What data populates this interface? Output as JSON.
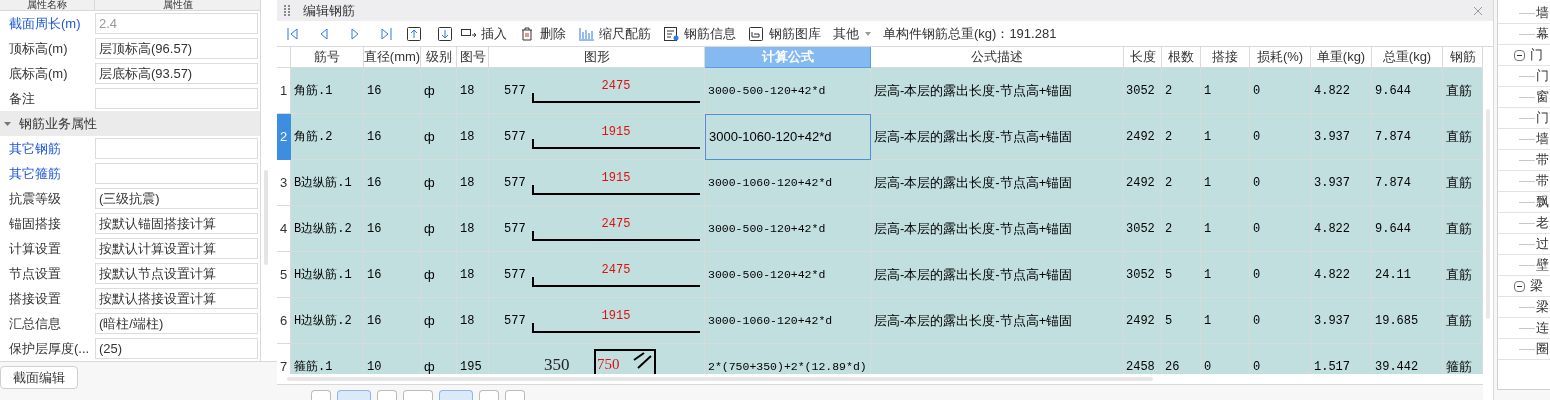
{
  "properties_panel": {
    "columns": [
      "属性名称",
      "属性值"
    ],
    "rows": [
      {
        "kind": "row",
        "label": "截面周长(m)",
        "value": "2.4",
        "emphasized": true,
        "disabled": true
      },
      {
        "kind": "row",
        "label": "顶标高(m)",
        "value": "层顶标高(96.57)",
        "emphasized": false,
        "disabled": false
      },
      {
        "kind": "row",
        "label": "底标高(m)",
        "value": "层底标高(93.57)",
        "emphasized": false,
        "disabled": false
      },
      {
        "kind": "row",
        "label": "备注",
        "emphasized": false
      },
      {
        "kind": "group",
        "label": "钢筋业务属性",
        "expanded": true
      },
      {
        "kind": "row",
        "label": "其它钢筋",
        "emphasized": true
      },
      {
        "kind": "row",
        "label": "其它箍筋",
        "emphasized": true
      },
      {
        "kind": "row",
        "label": "抗震等级",
        "value": "(三级抗震)",
        "emphasized": false,
        "disabled": false
      },
      {
        "kind": "row",
        "label": "锚固搭接",
        "value": "按默认锚固搭接计算",
        "emphasized": false,
        "disabled": false
      },
      {
        "kind": "row",
        "label": "计算设置",
        "value": "按默认计算设置计算",
        "emphasized": false,
        "disabled": false
      },
      {
        "kind": "row",
        "label": "节点设置",
        "value": "按默认节点设置计算",
        "emphasized": false,
        "disabled": false
      },
      {
        "kind": "row",
        "label": "搭接设置",
        "value": "按默认搭接设置计算",
        "emphasized": false,
        "disabled": false
      },
      {
        "kind": "row",
        "label": "汇总信息",
        "value": "(暗柱/端柱)",
        "emphasized": false,
        "disabled": false
      },
      {
        "kind": "row",
        "label": "保护层厚度(...",
        "value": "(25)",
        "emphasized": false,
        "disabled": false
      }
    ],
    "button": "截面编辑"
  },
  "editor": {
    "title": "编辑钢筋",
    "toolbar_labels": [
      "插入",
      "删除",
      "缩尺配筋",
      "钢筋信息",
      "钢筋图库"
    ],
    "menu": "其他",
    "total": "单构件钢筋总重(kg)：191.281",
    "columns": [
      {
        "label": "筋号",
        "selected": false
      },
      {
        "label": "直径(mm)",
        "selected": false
      },
      {
        "label": "级别",
        "selected": false
      },
      {
        "label": "图号",
        "selected": false
      },
      {
        "label": "图形",
        "selected": false
      },
      {
        "label": "计算公式",
        "selected": true
      },
      {
        "label": "公式描述",
        "selected": false
      },
      {
        "label": "长度",
        "selected": false
      },
      {
        "label": "根数",
        "selected": false
      },
      {
        "label": "搭接",
        "selected": false
      },
      {
        "label": "损耗(%)",
        "selected": false
      },
      {
        "label": "单重(kg)",
        "selected": false
      },
      {
        "label": "总重(kg)",
        "selected": false
      },
      {
        "label": "钢筋",
        "selected": false
      }
    ],
    "rows": [
      {
        "number": "1",
        "selected": false,
        "name": "角筋.1",
        "diameter": "16",
        "grade": "ф",
        "figure": "18",
        "shape": {
          "kind": "bent",
          "side": "577",
          "main": "2475"
        },
        "formula": "3000-500-120+42*d",
        "editing": false,
        "description": "层高-本层的露出长度-节点高+锚固",
        "length": "3052",
        "count": "2",
        "lap": "1",
        "loss": "0",
        "unit_weight": "4.822",
        "total_weight": "9.644",
        "type": "直筋"
      },
      {
        "number": "2",
        "selected": true,
        "name": "角筋.2",
        "diameter": "16",
        "grade": "ф",
        "figure": "18",
        "shape": {
          "kind": "bent",
          "side": "577",
          "main": "1915"
        },
        "formula": "3000-1060-120+42*d",
        "editing": true,
        "description": "层高-本层的露出长度-节点高+锚固",
        "length": "2492",
        "count": "2",
        "lap": "1",
        "loss": "0",
        "unit_weight": "3.937",
        "total_weight": "7.874",
        "type": "直筋"
      },
      {
        "number": "3",
        "selected": false,
        "name": "B边纵筋.1",
        "diameter": "16",
        "grade": "ф",
        "figure": "18",
        "shape": {
          "kind": "bent",
          "side": "577",
          "main": "1915"
        },
        "formula": "3000-1060-120+42*d",
        "editing": false,
        "description": "层高-本层的露出长度-节点高+锚固",
        "length": "2492",
        "count": "2",
        "lap": "1",
        "loss": "0",
        "unit_weight": "3.937",
        "total_weight": "7.874",
        "type": "直筋"
      },
      {
        "number": "4",
        "selected": false,
        "name": "B边纵筋.2",
        "diameter": "16",
        "grade": "ф",
        "figure": "18",
        "shape": {
          "kind": "bent",
          "side": "577",
          "main": "2475"
        },
        "formula": "3000-500-120+42*d",
        "editing": false,
        "description": "层高-本层的露出长度-节点高+锚固",
        "length": "3052",
        "count": "2",
        "lap": "1",
        "loss": "0",
        "unit_weight": "4.822",
        "total_weight": "9.644",
        "type": "直筋"
      },
      {
        "number": "5",
        "selected": false,
        "name": "H边纵筋.1",
        "diameter": "16",
        "grade": "ф",
        "figure": "18",
        "shape": {
          "kind": "bent",
          "side": "577",
          "main": "2475"
        },
        "formula": "3000-500-120+42*d",
        "editing": false,
        "description": "层高-本层的露出长度-节点高+锚固",
        "length": "3052",
        "count": "5",
        "lap": "1",
        "loss": "0",
        "unit_weight": "4.822",
        "total_weight": "24.11",
        "type": "直筋"
      },
      {
        "number": "6",
        "selected": false,
        "name": "H边纵筋.2",
        "diameter": "16",
        "grade": "ф",
        "figure": "18",
        "shape": {
          "kind": "bent",
          "side": "577",
          "main": "1915"
        },
        "formula": "3000-1060-120+42*d",
        "editing": false,
        "description": "层高-本层的露出长度-节点高+锚固",
        "length": "2492",
        "count": "5",
        "lap": "1",
        "loss": "0",
        "unit_weight": "3.937",
        "total_weight": "19.685",
        "type": "直筋"
      },
      {
        "number": "7",
        "selected": false,
        "name": "箍筋.1",
        "diameter": "10",
        "grade": "ф",
        "figure": "195",
        "shape": {
          "kind": "stirrup",
          "side": "350",
          "main": "750"
        },
        "formula": "2*(750+350)+2*(12.89*d)",
        "editing": false,
        "length": "2458",
        "count": "26",
        "lap": "0",
        "loss": "0",
        "unit_weight": "1.517",
        "total_weight": "39.442",
        "type": "箍筋"
      }
    ]
  },
  "tree": {
    "items": [
      {
        "label": "墙"
      },
      {
        "label": "幕"
      },
      {
        "label": "门",
        "expanded": true,
        "children": [
          {
            "label": "门"
          },
          {
            "label": "窗"
          },
          {
            "label": "门"
          },
          {
            "label": "墙"
          },
          {
            "label": "带"
          },
          {
            "label": "带"
          },
          {
            "label": "飘"
          },
          {
            "label": "老"
          },
          {
            "label": "过"
          },
          {
            "label": "壁"
          }
        ]
      },
      {
        "label": "梁",
        "expanded": true,
        "children": [
          {
            "label": "梁"
          },
          {
            "label": "连"
          },
          {
            "label": "圈"
          }
        ]
      }
    ]
  }
}
